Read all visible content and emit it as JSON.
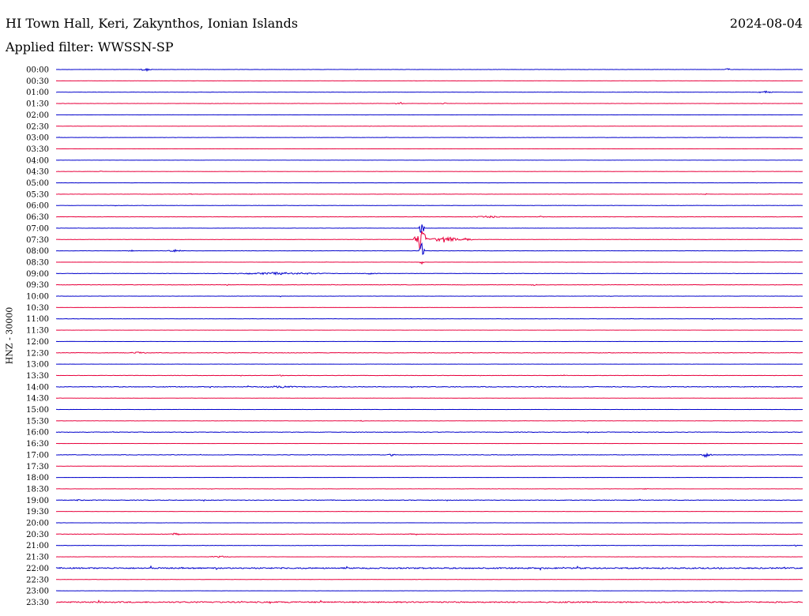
{
  "header": {
    "station": "HI Town Hall, Keri, Zakynthos, Ionian Islands",
    "date": "2024-08-04",
    "filter": "Applied filter: WWSSN-SP",
    "axis_label": "HNZ - 30000"
  },
  "colors": {
    "trace_a": "#0000cc",
    "trace_b": "#e8003c",
    "background": "#ffffff"
  },
  "chart_data": {
    "type": "line",
    "title": "HI Town Hall, Keri, Zakynthos, Ionian Islands",
    "ylabel": "HNZ - 30000",
    "xlabel": "",
    "rows": [
      {
        "label": "00:00",
        "color": "blue",
        "noise": 0.3,
        "events": [
          {
            "at": 0.12,
            "amp": 2,
            "width": 0.01
          },
          {
            "at": 0.9,
            "amp": 1.5,
            "width": 0.005
          }
        ]
      },
      {
        "label": "00:30",
        "color": "red",
        "noise": 0.2,
        "events": []
      },
      {
        "label": "01:00",
        "color": "blue",
        "noise": 0.3,
        "events": [
          {
            "at": 0.95,
            "amp": 1.5,
            "width": 0.015
          }
        ]
      },
      {
        "label": "01:30",
        "color": "red",
        "noise": 0.3,
        "events": [
          {
            "at": 0.46,
            "amp": 1.5,
            "width": 0.008
          },
          {
            "at": 0.52,
            "amp": 1,
            "width": 0.005
          }
        ]
      },
      {
        "label": "02:00",
        "color": "blue",
        "noise": 0.2,
        "events": []
      },
      {
        "label": "02:30",
        "color": "red",
        "noise": 0.2,
        "events": []
      },
      {
        "label": "03:00",
        "color": "blue",
        "noise": 0.3,
        "events": [
          {
            "at": 0.89,
            "amp": 1,
            "width": 0.004
          }
        ]
      },
      {
        "label": "03:30",
        "color": "red",
        "noise": 0.2,
        "events": []
      },
      {
        "label": "04:00",
        "color": "blue",
        "noise": 0.2,
        "events": []
      },
      {
        "label": "04:30",
        "color": "red",
        "noise": 0.2,
        "events": [
          {
            "at": 0.06,
            "amp": 1,
            "width": 0.003
          }
        ]
      },
      {
        "label": "05:00",
        "color": "blue",
        "noise": 0.2,
        "events": []
      },
      {
        "label": "05:30",
        "color": "red",
        "noise": 0.3,
        "events": [
          {
            "at": 0.18,
            "amp": 1,
            "width": 0.003
          },
          {
            "at": 0.87,
            "amp": 1,
            "width": 0.003
          }
        ]
      },
      {
        "label": "06:00",
        "color": "blue",
        "noise": 0.3,
        "events": [
          {
            "at": 0.08,
            "amp": 1,
            "width": 0.003
          }
        ]
      },
      {
        "label": "06:30",
        "color": "red",
        "noise": 0.4,
        "events": [
          {
            "at": 0.58,
            "amp": 1.2,
            "width": 0.03
          },
          {
            "at": 0.65,
            "amp": 1.5,
            "width": 0.006
          }
        ]
      },
      {
        "label": "07:00",
        "color": "blue",
        "noise": 0.3,
        "events": [
          {
            "at": 0.49,
            "amp": 11,
            "width": 0.004
          }
        ]
      },
      {
        "label": "07:30",
        "color": "red",
        "noise": 0.3,
        "events": [
          {
            "at": 0.49,
            "amp": 16,
            "width": 0.012
          },
          {
            "at": 0.52,
            "amp": 4,
            "width": 0.025
          },
          {
            "at": 0.55,
            "amp": 2,
            "width": 0.01
          }
        ]
      },
      {
        "label": "08:00",
        "color": "blue",
        "noise": 0.3,
        "events": [
          {
            "at": 0.1,
            "amp": 1.5,
            "width": 0.006
          },
          {
            "at": 0.16,
            "amp": 1.5,
            "width": 0.015
          },
          {
            "at": 0.49,
            "amp": 12,
            "width": 0.004
          }
        ]
      },
      {
        "label": "08:30",
        "color": "red",
        "noise": 0.2,
        "events": [
          {
            "at": 0.49,
            "amp": 5,
            "width": 0.003
          }
        ]
      },
      {
        "label": "09:00",
        "color": "blue",
        "noise": 0.4,
        "events": [
          {
            "at": 0.3,
            "amp": 1.5,
            "width": 0.08
          },
          {
            "at": 0.42,
            "amp": 1,
            "width": 0.02
          }
        ]
      },
      {
        "label": "09:30",
        "color": "red",
        "noise": 0.5,
        "events": [
          {
            "at": 0.23,
            "amp": 1,
            "width": 0.004
          },
          {
            "at": 0.64,
            "amp": 1,
            "width": 0.005
          }
        ]
      },
      {
        "label": "10:00",
        "color": "blue",
        "noise": 0.3,
        "events": [
          {
            "at": 0.3,
            "amp": 1.5,
            "width": 0.003
          }
        ]
      },
      {
        "label": "10:30",
        "color": "red",
        "noise": 0.2,
        "events": []
      },
      {
        "label": "11:00",
        "color": "blue",
        "noise": 0.3,
        "events": [
          {
            "at": 0.88,
            "amp": 1,
            "width": 0.004
          }
        ]
      },
      {
        "label": "11:30",
        "color": "red",
        "noise": 0.2,
        "events": []
      },
      {
        "label": "12:00",
        "color": "blue",
        "noise": 0.2,
        "events": []
      },
      {
        "label": "12:30",
        "color": "red",
        "noise": 0.6,
        "events": [
          {
            "at": 0.11,
            "amp": 1.2,
            "width": 0.02
          }
        ]
      },
      {
        "label": "13:00",
        "color": "blue",
        "noise": 0.2,
        "events": []
      },
      {
        "label": "13:30",
        "color": "red",
        "noise": 0.4,
        "events": [
          {
            "at": 0.3,
            "amp": 1.2,
            "width": 0.005
          },
          {
            "at": 0.68,
            "amp": 1,
            "width": 0.005
          }
        ]
      },
      {
        "label": "14:00",
        "color": "blue",
        "noise": 0.8,
        "events": [
          {
            "at": 0.3,
            "amp": 1.2,
            "width": 0.04
          }
        ]
      },
      {
        "label": "14:30",
        "color": "red",
        "noise": 0.2,
        "events": []
      },
      {
        "label": "15:00",
        "color": "blue",
        "noise": 0.2,
        "events": []
      },
      {
        "label": "15:30",
        "color": "red",
        "noise": 0.3,
        "events": [
          {
            "at": 0.41,
            "amp": 1,
            "width": 0.004
          }
        ]
      },
      {
        "label": "16:00",
        "color": "blue",
        "noise": 0.6,
        "events": []
      },
      {
        "label": "16:30",
        "color": "red",
        "noise": 0.2,
        "events": []
      },
      {
        "label": "17:00",
        "color": "blue",
        "noise": 0.6,
        "events": [
          {
            "at": 0.45,
            "amp": 1.2,
            "width": 0.01
          },
          {
            "at": 0.87,
            "amp": 3,
            "width": 0.012
          }
        ]
      },
      {
        "label": "17:30",
        "color": "red",
        "noise": 0.3,
        "events": []
      },
      {
        "label": "18:00",
        "color": "blue",
        "noise": 0.2,
        "events": []
      },
      {
        "label": "18:30",
        "color": "red",
        "noise": 0.3,
        "events": [
          {
            "at": 0.79,
            "amp": 1,
            "width": 0.005
          }
        ]
      },
      {
        "label": "19:00",
        "color": "blue",
        "noise": 0.7,
        "events": [
          {
            "at": 0.03,
            "amp": 1,
            "width": 0.01
          }
        ]
      },
      {
        "label": "19:30",
        "color": "red",
        "noise": 0.2,
        "events": []
      },
      {
        "label": "20:00",
        "color": "blue",
        "noise": 0.2,
        "events": []
      },
      {
        "label": "20:30",
        "color": "red",
        "noise": 0.5,
        "events": [
          {
            "at": 0.16,
            "amp": 1.5,
            "width": 0.008
          },
          {
            "at": 0.48,
            "amp": 1,
            "width": 0.01
          }
        ]
      },
      {
        "label": "21:00",
        "color": "blue",
        "noise": 0.4,
        "events": [
          {
            "at": 0.99,
            "amp": 1.2,
            "width": 0.004
          }
        ]
      },
      {
        "label": "21:30",
        "color": "red",
        "noise": 0.3,
        "events": [
          {
            "at": 0.22,
            "amp": 1,
            "width": 0.02
          }
        ]
      },
      {
        "label": "22:00",
        "color": "blue",
        "noise": 1.5,
        "events": []
      },
      {
        "label": "22:30",
        "color": "red",
        "noise": 0.2,
        "events": []
      },
      {
        "label": "23:00",
        "color": "blue",
        "noise": 0.2,
        "events": []
      },
      {
        "label": "23:30",
        "color": "red",
        "noise": 1.5,
        "events": []
      }
    ]
  }
}
